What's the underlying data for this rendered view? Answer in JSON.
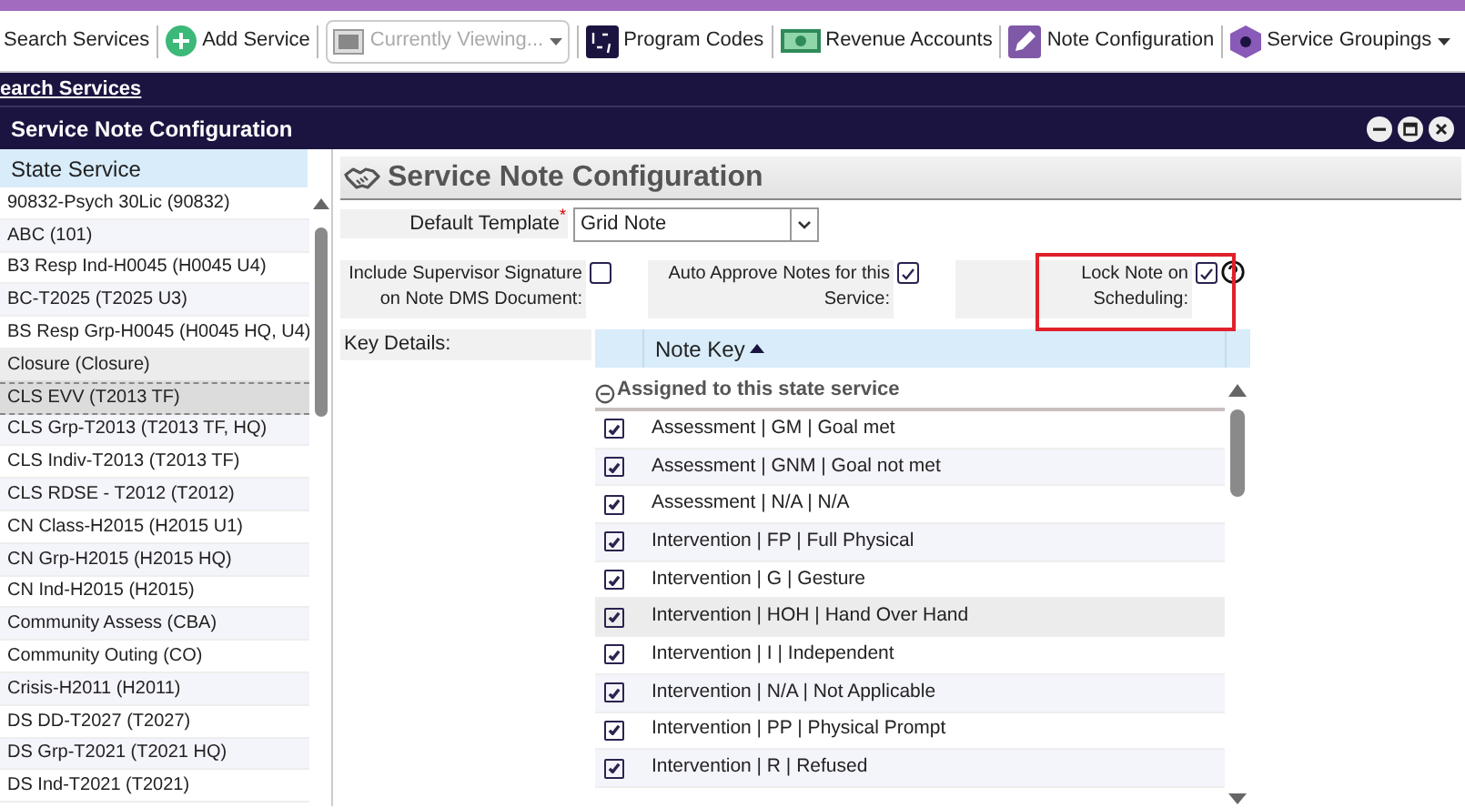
{
  "toolbar": {
    "items": [
      {
        "kind": "link",
        "label": "Search Services"
      },
      {
        "kind": "add",
        "label": "Add Service"
      },
      {
        "kind": "dropdown",
        "label": "Currently Viewing...",
        "disabled": true
      },
      {
        "kind": "codes",
        "label": "Program Codes"
      },
      {
        "kind": "money",
        "label": "Revenue Accounts"
      },
      {
        "kind": "note",
        "label": "Note Configuration"
      },
      {
        "kind": "groups",
        "label": "Service Groupings"
      }
    ]
  },
  "breadcrumb": "earch Services",
  "window": {
    "title": "Service Note Configuration"
  },
  "service_list": {
    "header": "State Service",
    "items": [
      {
        "label": "90832-Psych 30Lic (90832)",
        "selected": false,
        "hovered": false
      },
      {
        "label": "ABC (101)",
        "selected": false,
        "hovered": false
      },
      {
        "label": "B3 Resp Ind-H0045 (H0045 U4)",
        "selected": false,
        "hovered": false
      },
      {
        "label": "BC-T2025 (T2025 U3)",
        "selected": false,
        "hovered": false
      },
      {
        "label": "BS Resp Grp-H0045 (H0045 HQ, U4)",
        "selected": false,
        "hovered": false
      },
      {
        "label": "Closure (Closure)",
        "selected": false,
        "hovered": true
      },
      {
        "label": "CLS EVV (T2013 TF)",
        "selected": true,
        "hovered": false
      },
      {
        "label": "CLS Grp-T2013 (T2013 TF, HQ)",
        "selected": false,
        "hovered": false
      },
      {
        "label": "CLS Indiv-T2013 (T2013 TF)",
        "selected": false,
        "hovered": false
      },
      {
        "label": "CLS RDSE - T2012 (T2012)",
        "selected": false,
        "hovered": false
      },
      {
        "label": "CN Class-H2015 (H2015 U1)",
        "selected": false,
        "hovered": false
      },
      {
        "label": "CN Grp-H2015 (H2015 HQ)",
        "selected": false,
        "hovered": false
      },
      {
        "label": "CN Ind-H2015 (H2015)",
        "selected": false,
        "hovered": false
      },
      {
        "label": "Community Assess (CBA)",
        "selected": false,
        "hovered": false
      },
      {
        "label": "Community Outing (CO)",
        "selected": false,
        "hovered": false
      },
      {
        "label": "Crisis-H2011 (H2011)",
        "selected": false,
        "hovered": false
      },
      {
        "label": "DS DD-T2027 (T2027)",
        "selected": false,
        "hovered": false
      },
      {
        "label": "DS Grp-T2021 (T2021 HQ)",
        "selected": false,
        "hovered": false
      },
      {
        "label": "DS Ind-T2021 (T2021)",
        "selected": false,
        "hovered": false
      }
    ]
  },
  "form": {
    "heading": "Service Note Configuration",
    "default_template": {
      "label": "Default Template",
      "required_mark": "*",
      "value": "Grid Note"
    },
    "options": [
      {
        "label": "Include Supervisor Signature on Note DMS Document:",
        "checked": false,
        "help": false,
        "highlighted": false
      },
      {
        "label": "Auto Approve Notes for this Service:",
        "checked": true,
        "help": false,
        "highlighted": false
      },
      {
        "label": "Lock Note on Scheduling:",
        "checked": true,
        "help": true,
        "highlighted": true
      }
    ],
    "key_details_label": "Key Details:",
    "grid": {
      "column": "Note Key",
      "group": "Assigned to this state service",
      "rows": [
        {
          "label": "Assessment | GM | Goal met",
          "checked": true,
          "hovered": false
        },
        {
          "label": "Assessment | GNM | Goal not met",
          "checked": true,
          "hovered": false
        },
        {
          "label": "Assessment | N/A | N/A",
          "checked": true,
          "hovered": false
        },
        {
          "label": "Intervention | FP | Full Physical",
          "checked": true,
          "hovered": false
        },
        {
          "label": "Intervention | G | Gesture",
          "checked": true,
          "hovered": false
        },
        {
          "label": "Intervention | HOH | Hand Over Hand",
          "checked": true,
          "hovered": true
        },
        {
          "label": "Intervention | I | Independent",
          "checked": true,
          "hovered": false
        },
        {
          "label": "Intervention | N/A | Not Applicable",
          "checked": true,
          "hovered": false
        },
        {
          "label": "Intervention | PP | Physical Prompt",
          "checked": true,
          "hovered": false
        },
        {
          "label": "Intervention | R | Refused",
          "checked": true,
          "hovered": false
        }
      ]
    }
  }
}
